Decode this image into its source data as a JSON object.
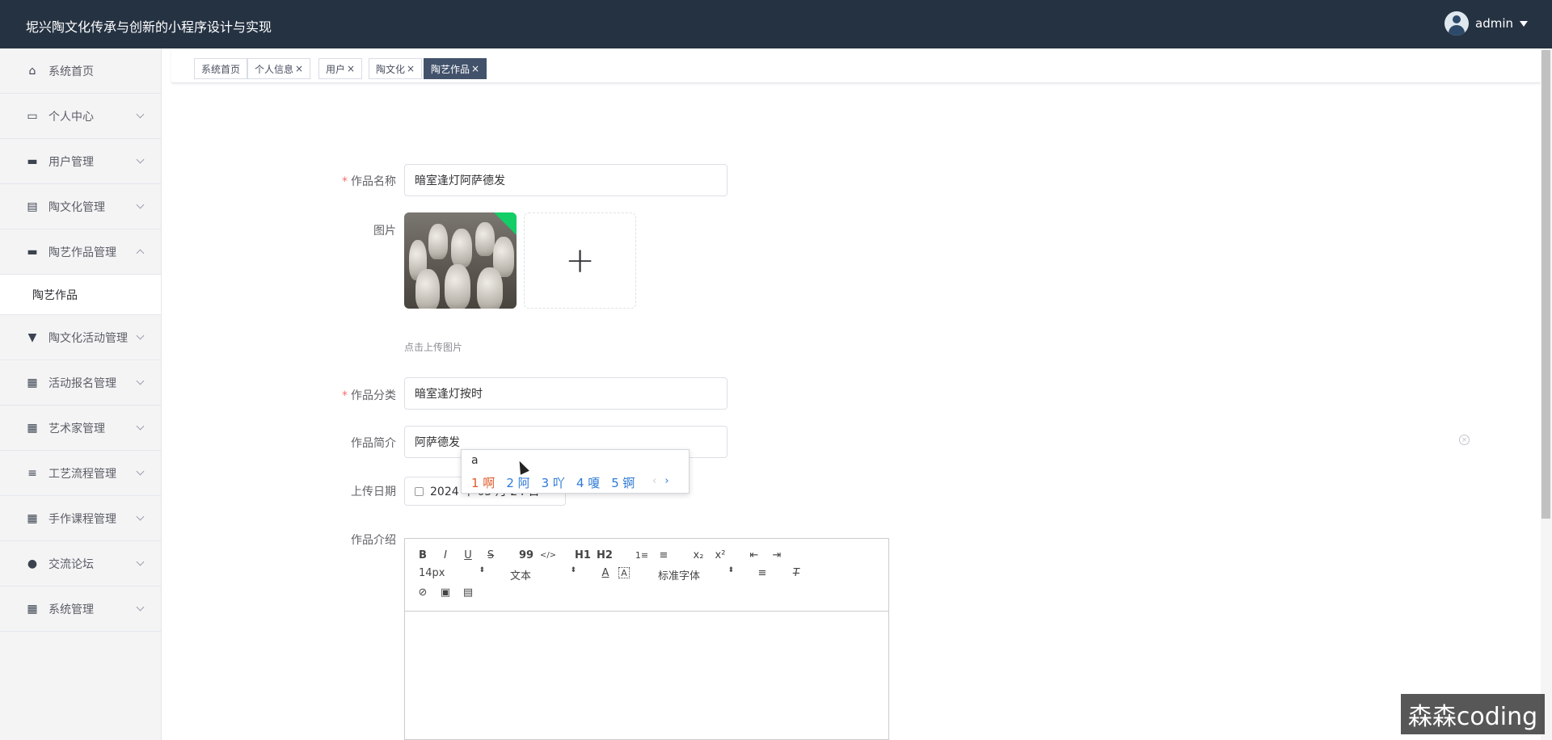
{
  "header": {
    "title": "坭兴陶文化传承与创新的小程序设计与实现",
    "username": "admin"
  },
  "sidebar": {
    "items": [
      {
        "label": "系统首页",
        "icon": "home-icon"
      },
      {
        "label": "个人中心",
        "icon": "card-icon"
      },
      {
        "label": "用户管理",
        "icon": "monitor-icon"
      },
      {
        "label": "陶文化管理",
        "icon": "clipboard-icon"
      },
      {
        "label": "陶艺作品管理",
        "icon": "monitor-icon",
        "expanded": true
      },
      {
        "label": "陶文化活动管理",
        "icon": "brush-icon"
      },
      {
        "label": "活动报名管理",
        "icon": "grid-icon"
      },
      {
        "label": "艺术家管理",
        "icon": "grid-icon"
      },
      {
        "label": "工艺流程管理",
        "icon": "list-icon"
      },
      {
        "label": "手作课程管理",
        "icon": "grid-icon"
      },
      {
        "label": "交流论坛",
        "icon": "bulb-icon"
      },
      {
        "label": "系统管理",
        "icon": "grid-icon"
      }
    ],
    "subitem": "陶艺作品"
  },
  "tabs": [
    {
      "label": "系统首页",
      "closable": false
    },
    {
      "label": "个人信息",
      "closable": true
    },
    {
      "label": "用户",
      "closable": true
    },
    {
      "label": "陶文化",
      "closable": true
    },
    {
      "label": "陶艺作品",
      "closable": true,
      "active": true
    }
  ],
  "tab_close": "×",
  "form": {
    "name_label": "作品名称",
    "name_value": "暗室逢灯阿萨德发",
    "image_label": "图片",
    "upload_hint": "点击上传图片",
    "upload_plus": "+",
    "category_label": "作品分类",
    "category_value": "暗室逢灯按时",
    "intro_label": "作品简介",
    "intro_value": "阿萨德发",
    "date_label": "上传日期",
    "date_value": "2024 年 05 月 24 日",
    "content_label": "作品介绍",
    "required_mark": "*"
  },
  "ime": {
    "composition": "a",
    "candidates": [
      "1 啊",
      "2 阿",
      "3 吖",
      "4 嗄",
      "5 锕"
    ],
    "prev": "‹",
    "next": "›"
  },
  "editor": {
    "font_size": "14px",
    "block_format": "文本",
    "font_family": "标准字体",
    "buttons": [
      "B",
      "I",
      "U",
      "S",
      "99",
      "</>",
      "H1",
      "H2",
      "1≡",
      "≡",
      "x₂",
      "x²",
      "⇤",
      "⇥"
    ]
  },
  "watermark": "森森coding",
  "colors": {
    "header_bg": "#253242",
    "active_tab": "#42526b",
    "required": "#f56c6c"
  }
}
